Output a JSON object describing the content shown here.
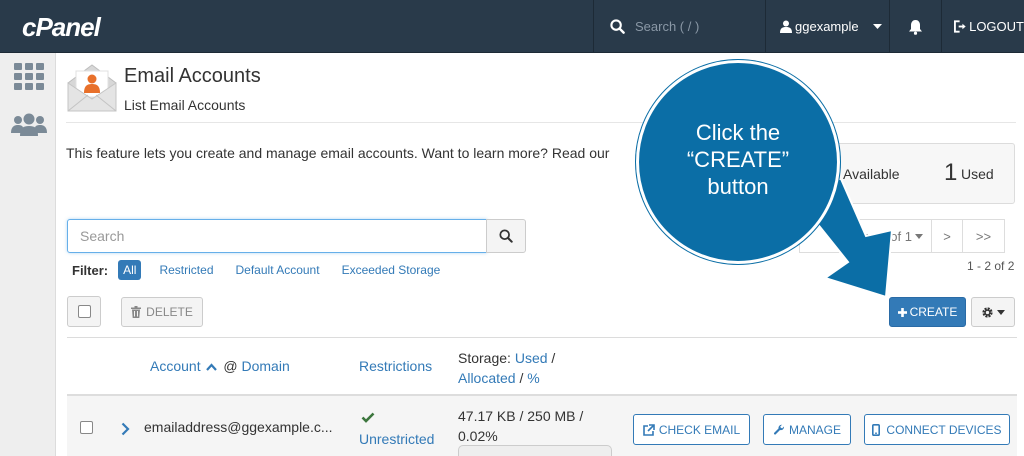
{
  "topbar": {
    "logo": "cPanel",
    "search_placeholder": "Search ( / )",
    "username": "ggexample",
    "logout_label": "LOGOUT"
  },
  "header": {
    "title": "Email Accounts",
    "subtitle": "List Email Accounts"
  },
  "description": "This feature lets you create and manage email accounts. Want to learn more? Read our",
  "stats": {
    "available_label": "Available",
    "used_count": "1",
    "used_label": "Used"
  },
  "search": {
    "placeholder": "Search"
  },
  "pagination": {
    "page_label": "ge 1 of 1",
    "next": ">",
    "last": ">>",
    "count": "1 - 2 of 2"
  },
  "filter": {
    "label": "Filter:",
    "options": [
      "All",
      "Restricted",
      "Default Account",
      "Exceeded Storage"
    ],
    "active": "All"
  },
  "toolbar": {
    "delete_label": "DELETE",
    "create_label": "CREATE"
  },
  "table": {
    "headers": {
      "account": "Account",
      "at": "@",
      "domain": "Domain",
      "restrictions": "Restrictions",
      "storage": "Storage:",
      "used": "Used",
      "slash1": "/",
      "allocated": "Allocated",
      "slash2": "/",
      "percent": "%"
    },
    "rows": [
      {
        "account": "emailaddress@ggexample.c...",
        "restriction": "Unrestricted",
        "storage_line1": "47.17 KB / 250 MB /",
        "storage_line2": "0.02%",
        "storage_fraction": 0.0002,
        "check_email_label": "CHECK EMAIL",
        "manage_label": "MANAGE",
        "connect_label": "CONNECT DEVICES"
      }
    ]
  },
  "callout": {
    "line1": "Click the",
    "line2": "“CREATE”",
    "line3": "button"
  },
  "colors": {
    "topbar": "#293a4a",
    "primary": "#337ab7",
    "callout": "#0b6ea6",
    "success": "#3c763d"
  }
}
